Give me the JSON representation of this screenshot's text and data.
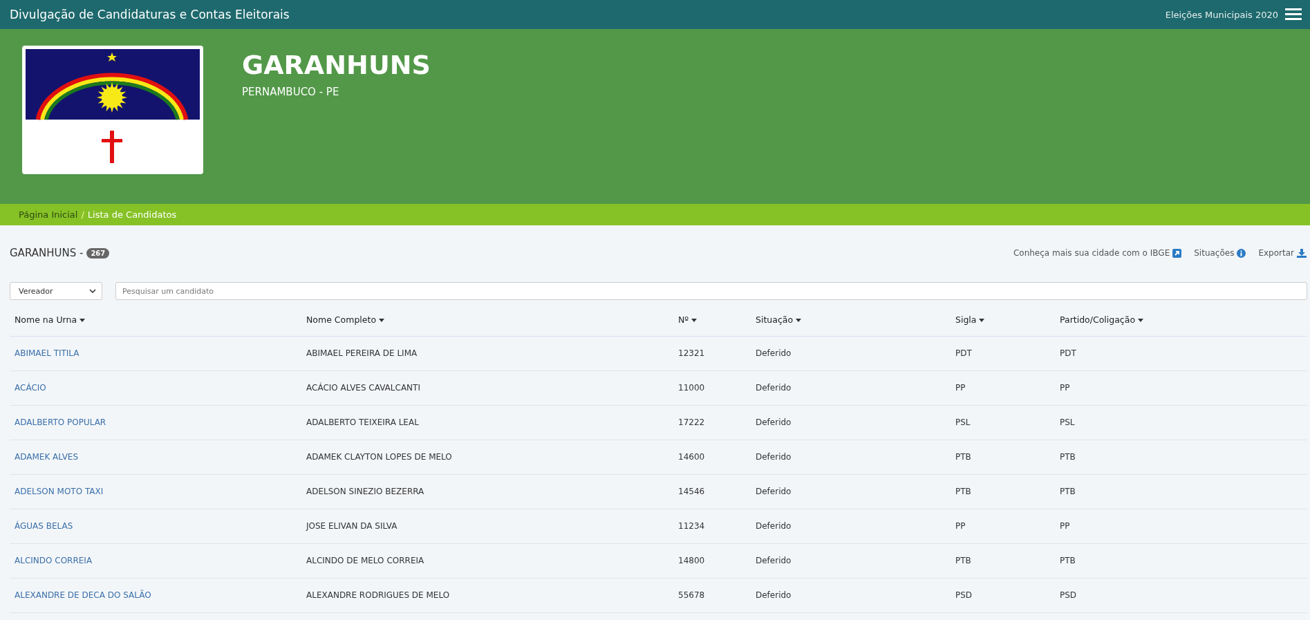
{
  "top_bar": {
    "title": "Divulgação de Candidaturas e Contas Eleitorais",
    "election": "Eleições Municipais 2020"
  },
  "header": {
    "city": "GARANHUNS",
    "state": "PERNAMBUCO - PE"
  },
  "breadcrumb_separator": "/",
  "breadcrumb": [
    {
      "label": "Página Inicial",
      "selected": false
    },
    {
      "label": "Lista de Candidatos",
      "selected": true
    }
  ],
  "list_title": {
    "city": "GARANHUNS -",
    "count": "267"
  },
  "actions": [
    {
      "label": "Conheça mais sua cidade com o IBGE",
      "kind": "external"
    },
    {
      "label": "Situações",
      "kind": "info"
    },
    {
      "label": "Exportar",
      "kind": "download"
    }
  ],
  "filter": {
    "value": "Vereador"
  },
  "search": {
    "placeholder": "Pesquisar um candidato"
  },
  "table": {
    "columns": [
      "Nome na Urna",
      "Nome Completo",
      "Nº",
      "Situação",
      "Sigla",
      "Partido/Coligação"
    ],
    "rows": [
      [
        "ABIMAEL TITILA",
        "ABIMAEL PEREIRA DE LIMA",
        "12321",
        "Deferido",
        "PDT",
        "PDT"
      ],
      [
        "ACÁCIO",
        "ACÁCIO ALVES CAVALCANTI",
        "11000",
        "Deferido",
        "PP",
        "PP"
      ],
      [
        "ADALBERTO POPULAR",
        "ADALBERTO TEIXEIRA LEAL",
        "17222",
        "Deferido",
        "PSL",
        "PSL"
      ],
      [
        "ADAMEK ALVES",
        "ADAMEK CLAYTON LOPES DE MELO",
        "14600",
        "Deferido",
        "PTB",
        "PTB"
      ],
      [
        "ADELSON MOTO TAXI",
        "ADELSON SINEZIO BEZERRA",
        "14546",
        "Deferido",
        "PTB",
        "PTB"
      ],
      [
        "ÁGUAS BELAS",
        "JOSE ELIVAN DA SILVA",
        "11234",
        "Deferido",
        "PP",
        "PP"
      ],
      [
        "ALCINDO CORREIA",
        "ALCINDO DE MELO CORREIA",
        "14800",
        "Deferido",
        "PTB",
        "PTB"
      ],
      [
        "ALEXANDRE DE DECA DO SALÃO",
        "ALEXANDRE RODRIGUES DE MELO",
        "55678",
        "Deferido",
        "PSD",
        "PSD"
      ]
    ]
  }
}
